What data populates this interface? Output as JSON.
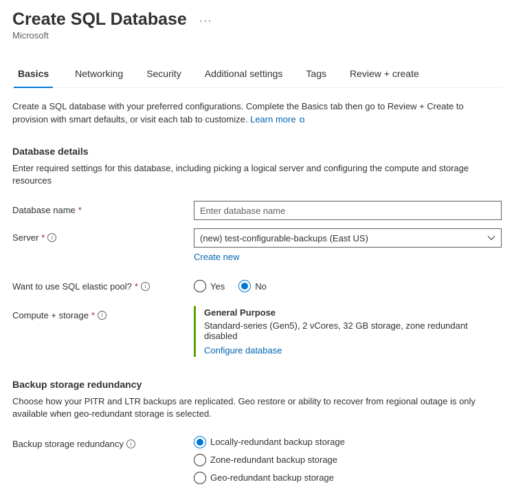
{
  "header": {
    "title": "Create SQL Database",
    "subtitle": "Microsoft"
  },
  "tabs": {
    "items": [
      {
        "label": "Basics",
        "active": true
      },
      {
        "label": "Networking",
        "active": false
      },
      {
        "label": "Security",
        "active": false
      },
      {
        "label": "Additional settings",
        "active": false
      },
      {
        "label": "Tags",
        "active": false
      },
      {
        "label": "Review + create",
        "active": false
      }
    ]
  },
  "intro": {
    "text": "Create a SQL database with your preferred configurations. Complete the Basics tab then go to Review + Create to provision with smart defaults, or visit each tab to customize. ",
    "learn_more": "Learn more"
  },
  "database_details": {
    "heading": "Database details",
    "desc": "Enter required settings for this database, including picking a logical server and configuring the compute and storage resources",
    "database_name": {
      "label": "Database name",
      "placeholder": "Enter database name",
      "value": ""
    },
    "server": {
      "label": "Server",
      "value": "(new) test-configurable-backups (East US)",
      "create_new": "Create new"
    },
    "elastic_pool": {
      "label": "Want to use SQL elastic pool?",
      "yes": "Yes",
      "no": "No",
      "selected": "No"
    },
    "compute": {
      "label": "Compute + storage",
      "title": "General Purpose",
      "desc": "Standard-series (Gen5), 2 vCores, 32 GB storage, zone redundant disabled",
      "configure": "Configure database"
    }
  },
  "backup": {
    "heading": "Backup storage redundancy",
    "desc": "Choose how your PITR and LTR backups are replicated. Geo restore or ability to recover from regional outage is only available when geo-redundant storage is selected.",
    "label": "Backup storage redundancy",
    "options": {
      "local": "Locally-redundant backup storage",
      "zone": "Zone-redundant backup storage",
      "geo": "Geo-redundant backup storage"
    },
    "selected": "local"
  }
}
